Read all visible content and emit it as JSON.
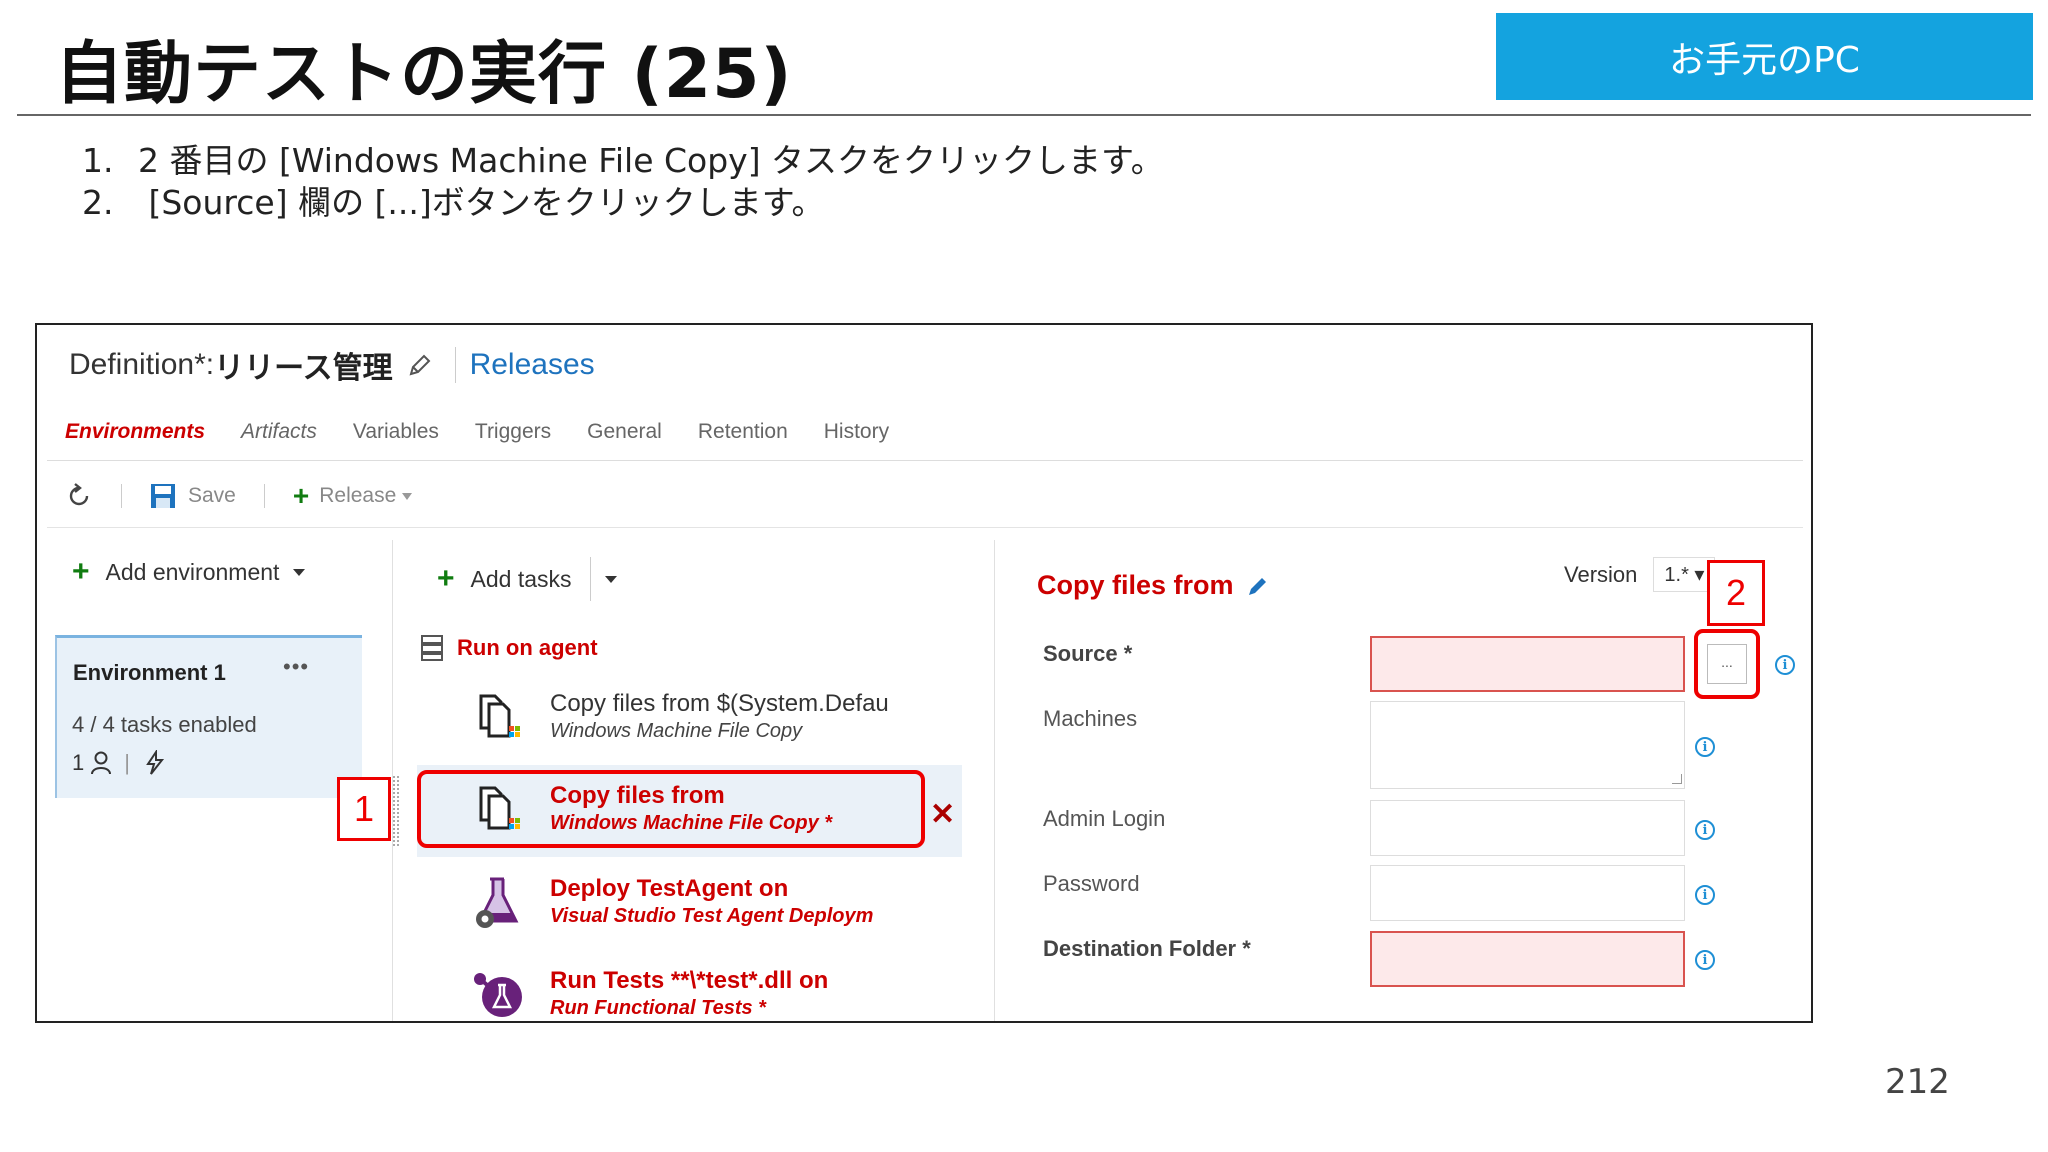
{
  "slide": {
    "title": "自動テストの実行 (25)",
    "badge": "お手元のPC",
    "instructions": [
      {
        "num": "1.",
        "text": "2 番目の [Windows Machine File Copy] タスクをクリックします。"
      },
      {
        "num": "2.",
        "text": " [Source] 欄の [...]ボタンをクリックします。"
      }
    ],
    "page_number": "212"
  },
  "screenshot": {
    "header": {
      "prefix": "Definition*: ",
      "name": "リリース管理",
      "releases_link": "Releases"
    },
    "tabs": [
      "Environments",
      "Artifacts",
      "Variables",
      "Triggers",
      "General",
      "Retention",
      "History"
    ],
    "active_tab": "Environments",
    "toolbar": {
      "save": "Save",
      "release": "Release"
    },
    "environments": {
      "add_label": "Add environment",
      "card": {
        "name": "Environment 1",
        "tasks_enabled": "4 / 4 tasks enabled",
        "approver_count": "1",
        "more": "•••"
      }
    },
    "tasks": {
      "add_label": "Add tasks",
      "phase": "Run on agent",
      "items": [
        {
          "title": "Copy files from $(System.Defau",
          "subtitle": "Windows Machine File Copy"
        },
        {
          "title": "Copy files from",
          "subtitle": "Windows Machine File Copy *"
        },
        {
          "title": "Deploy TestAgent on",
          "subtitle": "Visual Studio Test Agent Deploym"
        },
        {
          "title": "Run Tests **\\*test*.dll on",
          "subtitle": "Run Functional Tests *"
        }
      ],
      "remove_symbol": "✕"
    },
    "detail": {
      "title": "Copy files from",
      "version_label": "Version",
      "version_value": "1.*",
      "fields": {
        "source": "Source *",
        "machines": "Machines",
        "admin_login": "Admin Login",
        "password": "Password",
        "destination": "Destination Folder *"
      },
      "browse_label": "..."
    },
    "callouts": {
      "one": "1",
      "two": "2"
    }
  },
  "colors": {
    "badge": "#14a3df",
    "error": "#c00",
    "callout": "#e00",
    "link": "#1e73be",
    "add_green": "#107c10"
  }
}
